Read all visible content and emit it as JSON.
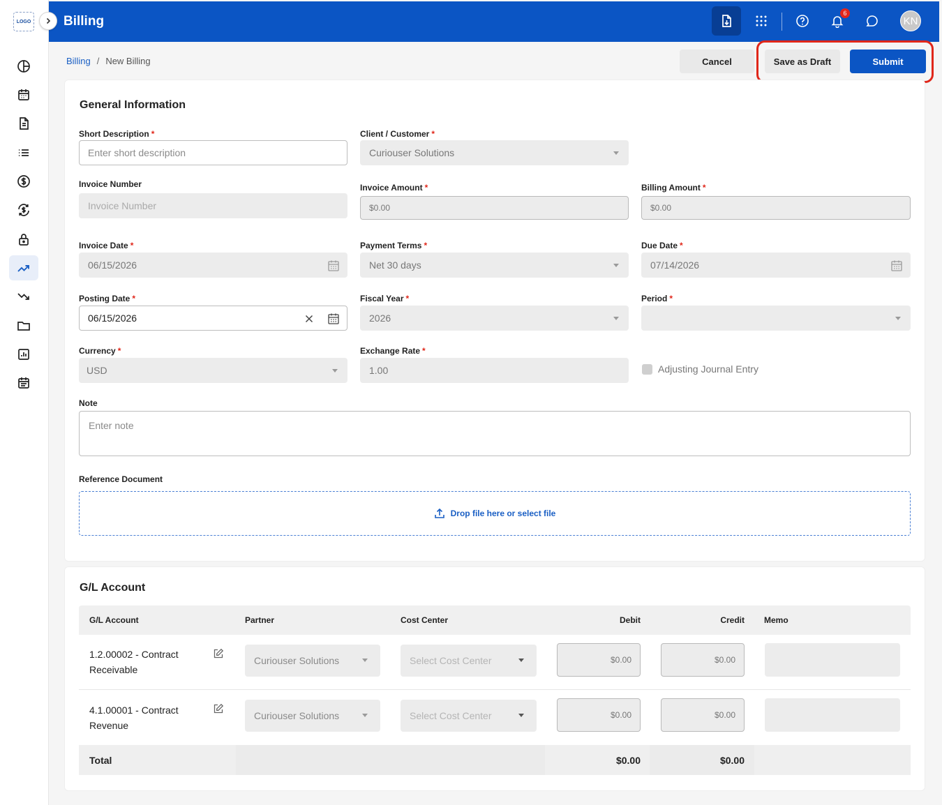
{
  "app": {
    "logo_text": "LOGO",
    "title": "Billing",
    "notification_count": "6",
    "user_initials": "KN"
  },
  "sidebar_icons": [
    "dashboard-icon",
    "calendar-icon",
    "document-icon",
    "list-icon",
    "dollar-icon",
    "currency-exchange-icon",
    "lock-icon",
    "trending-up-icon",
    "trending-down-icon",
    "folder-icon",
    "report-icon",
    "schedule-icon"
  ],
  "breadcrumb": {
    "parent": "Billing",
    "separator": "/",
    "current": "New Billing"
  },
  "actions": {
    "cancel": "Cancel",
    "save_draft": "Save as Draft",
    "submit": "Submit"
  },
  "general": {
    "title": "General Information",
    "short_description": {
      "label": "Short Description",
      "placeholder": "Enter short description"
    },
    "client": {
      "label": "Client / Customer",
      "value": "Curiouser Solutions"
    },
    "invoice_number": {
      "label": "Invoice Number",
      "placeholder": "Invoice Number"
    },
    "invoice_amount": {
      "label": "Invoice Amount",
      "value": "$0.00"
    },
    "billing_amount": {
      "label": "Billing Amount",
      "value": "$0.00"
    },
    "invoice_date": {
      "label": "Invoice Date",
      "value": "06/15/2026"
    },
    "payment_terms": {
      "label": "Payment Terms",
      "value": "Net 30 days"
    },
    "due_date": {
      "label": "Due Date",
      "value": "07/14/2026"
    },
    "posting_date": {
      "label": "Posting Date",
      "value": "06/15/2026"
    },
    "fiscal_year": {
      "label": "Fiscal Year",
      "value": "2026"
    },
    "period": {
      "label": "Period",
      "value": ""
    },
    "currency": {
      "label": "Currency",
      "value": "USD"
    },
    "exchange_rate": {
      "label": "Exchange Rate",
      "value": "1.00"
    },
    "adjusting_entry": {
      "label": "Adjusting Journal Entry"
    },
    "note": {
      "label": "Note",
      "placeholder": "Enter note"
    },
    "reference": {
      "label": "Reference Document",
      "drop_text": "Drop file here or select file"
    }
  },
  "gl": {
    "title": "G/L Account",
    "columns": {
      "account": "G/L Account",
      "partner": "Partner",
      "cost_center": "Cost Center",
      "debit": "Debit",
      "credit": "Credit",
      "memo": "Memo"
    },
    "rows": [
      {
        "account_line1": "1.2.00002 - Contract",
        "account_line2": "Receivable",
        "partner": "Curiouser Solutions",
        "cost_center_placeholder": "Select Cost Center",
        "debit": "$0.00",
        "credit": "$0.00"
      },
      {
        "account_line1": "4.1.00001 - Contract",
        "account_line2": "Revenue",
        "partner": "Curiouser Solutions",
        "cost_center_placeholder": "Select Cost Center",
        "debit": "$0.00",
        "credit": "$0.00"
      }
    ],
    "total": {
      "label": "Total",
      "debit": "$0.00",
      "credit": "$0.00"
    }
  }
}
